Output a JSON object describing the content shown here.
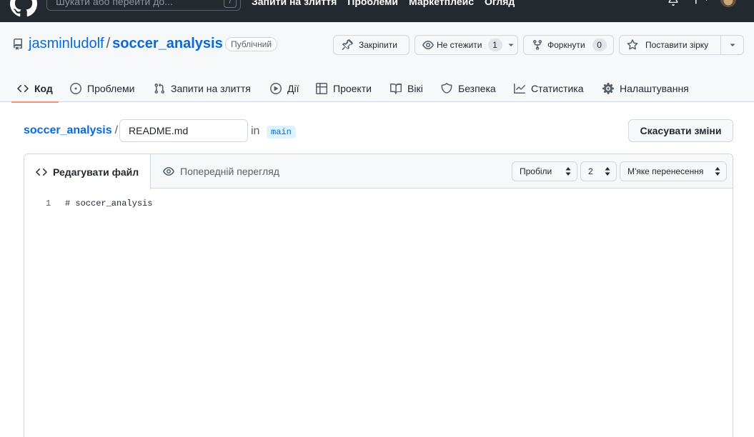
{
  "header": {
    "search_placeholder": "Шукати або перейти до...",
    "search_shortcut": "/",
    "nav": [
      "Запити на злиття",
      "Проблеми",
      "Маркетплейс",
      "Огляд"
    ]
  },
  "repo": {
    "owner": "jasminludolf",
    "separator": "/",
    "name": "soccer_analysis",
    "visibility": "Публічний",
    "actions": {
      "pin": "Закріпити",
      "watch": "Не стежити",
      "watch_count": "1",
      "fork": "Форкнути",
      "fork_count": "0",
      "star": "Поставити зірку"
    },
    "tabs": [
      "Код",
      "Проблеми",
      "Запити на злиття",
      "Дії",
      "Проекти",
      "Вікі",
      "Безпека",
      "Статистика",
      "Налаштування"
    ]
  },
  "edit": {
    "breadcrumb_repo": "soccer_analysis",
    "breadcrumb_sep": "/",
    "filename": "README.md",
    "in_label": "in",
    "branch": "main",
    "cancel": "Скасувати зміни",
    "tab_edit": "Редагувати файл",
    "tab_preview": "Попередній перегляд",
    "indent_mode": "Пробіли",
    "indent_size": "2",
    "wrap_mode": "М'яке перенесення"
  },
  "code_lines": [
    {
      "number": "1",
      "text": "# soccer_analysis"
    }
  ],
  "colors": {
    "header_bg": "#24292f",
    "link": "#0969da",
    "active_tab_underline": "#fd8c73",
    "branch_bg": "#ddf4ff"
  }
}
